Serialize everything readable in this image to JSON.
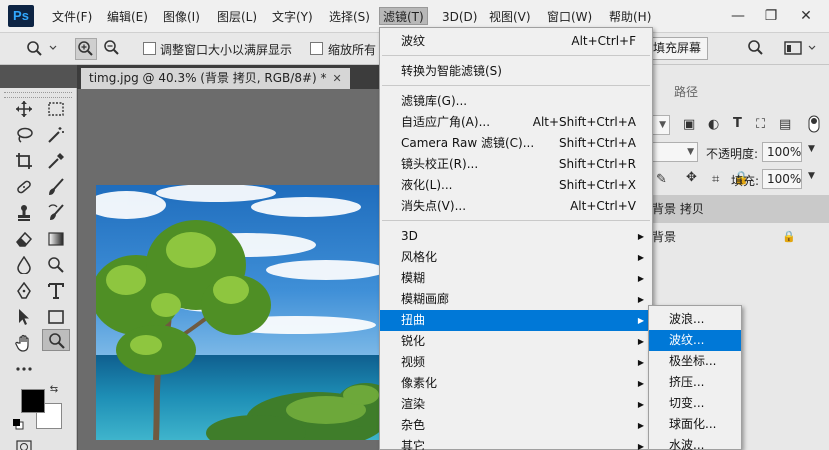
{
  "app": {
    "logo": "Ps"
  },
  "menubar": {
    "items": [
      "文件(F)",
      "编辑(E)",
      "图像(I)",
      "图层(L)",
      "文字(Y)",
      "选择(S)",
      "滤镜(T)",
      "3D(D)",
      "视图(V)",
      "窗口(W)",
      "帮助(H)"
    ],
    "active": "滤镜(T)"
  },
  "window_controls": {
    "minimize": "—",
    "restore": "❐",
    "close": "✕"
  },
  "options_bar": {
    "resize_window_label": "调整窗口大小以满屏显示",
    "zoom_all_label": "缩放所有",
    "fill_screen_label": "填充屏幕"
  },
  "document_tab": {
    "title": "timg.jpg @ 40.3% (背景 拷贝, RGB/8#) *",
    "close": "✕"
  },
  "right_panel": {
    "tab_paths": "路径",
    "opacity_label": "不透明度:",
    "opacity_value": "100%",
    "fill_label": "填充:",
    "fill_value": "100%",
    "layers": [
      {
        "name": "背景 拷贝",
        "selected": true
      },
      {
        "name": "背景",
        "selected": false
      }
    ]
  },
  "filter_menu": {
    "items": [
      {
        "label": "波纹",
        "shortcut": "Alt+Ctrl+F"
      },
      {
        "label": "转换为智能滤镜(S)",
        "shortcut": ""
      },
      {
        "label": "滤镜库(G)...",
        "shortcut": ""
      },
      {
        "label": "自适应广角(A)...",
        "shortcut": "Alt+Shift+Ctrl+A"
      },
      {
        "label": "Camera Raw 滤镜(C)...",
        "shortcut": "Shift+Ctrl+A"
      },
      {
        "label": "镜头校正(R)...",
        "shortcut": "Shift+Ctrl+R"
      },
      {
        "label": "液化(L)...",
        "shortcut": "Shift+Ctrl+X"
      },
      {
        "label": "消失点(V)...",
        "shortcut": "Alt+Ctrl+V"
      },
      {
        "label": "3D",
        "submenu": true
      },
      {
        "label": "风格化",
        "submenu": true
      },
      {
        "label": "模糊",
        "submenu": true
      },
      {
        "label": "模糊画廊",
        "submenu": true
      },
      {
        "label": "扭曲",
        "submenu": true,
        "highlighted": true
      },
      {
        "label": "锐化",
        "submenu": true
      },
      {
        "label": "视频",
        "submenu": true
      },
      {
        "label": "像素化",
        "submenu": true
      },
      {
        "label": "渲染",
        "submenu": true
      },
      {
        "label": "杂色",
        "submenu": true
      },
      {
        "label": "其它",
        "submenu": true
      }
    ]
  },
  "distort_submenu": {
    "items": [
      "波浪...",
      "波纹...",
      "极坐标...",
      "挤压...",
      "切变...",
      "球面化...",
      "水波..."
    ],
    "highlighted": "波纹..."
  },
  "colors": {
    "menu_highlight": "#0078d7",
    "ps_logo_bg": "#0d2444",
    "ps_logo_fg": "#31a8ff"
  }
}
